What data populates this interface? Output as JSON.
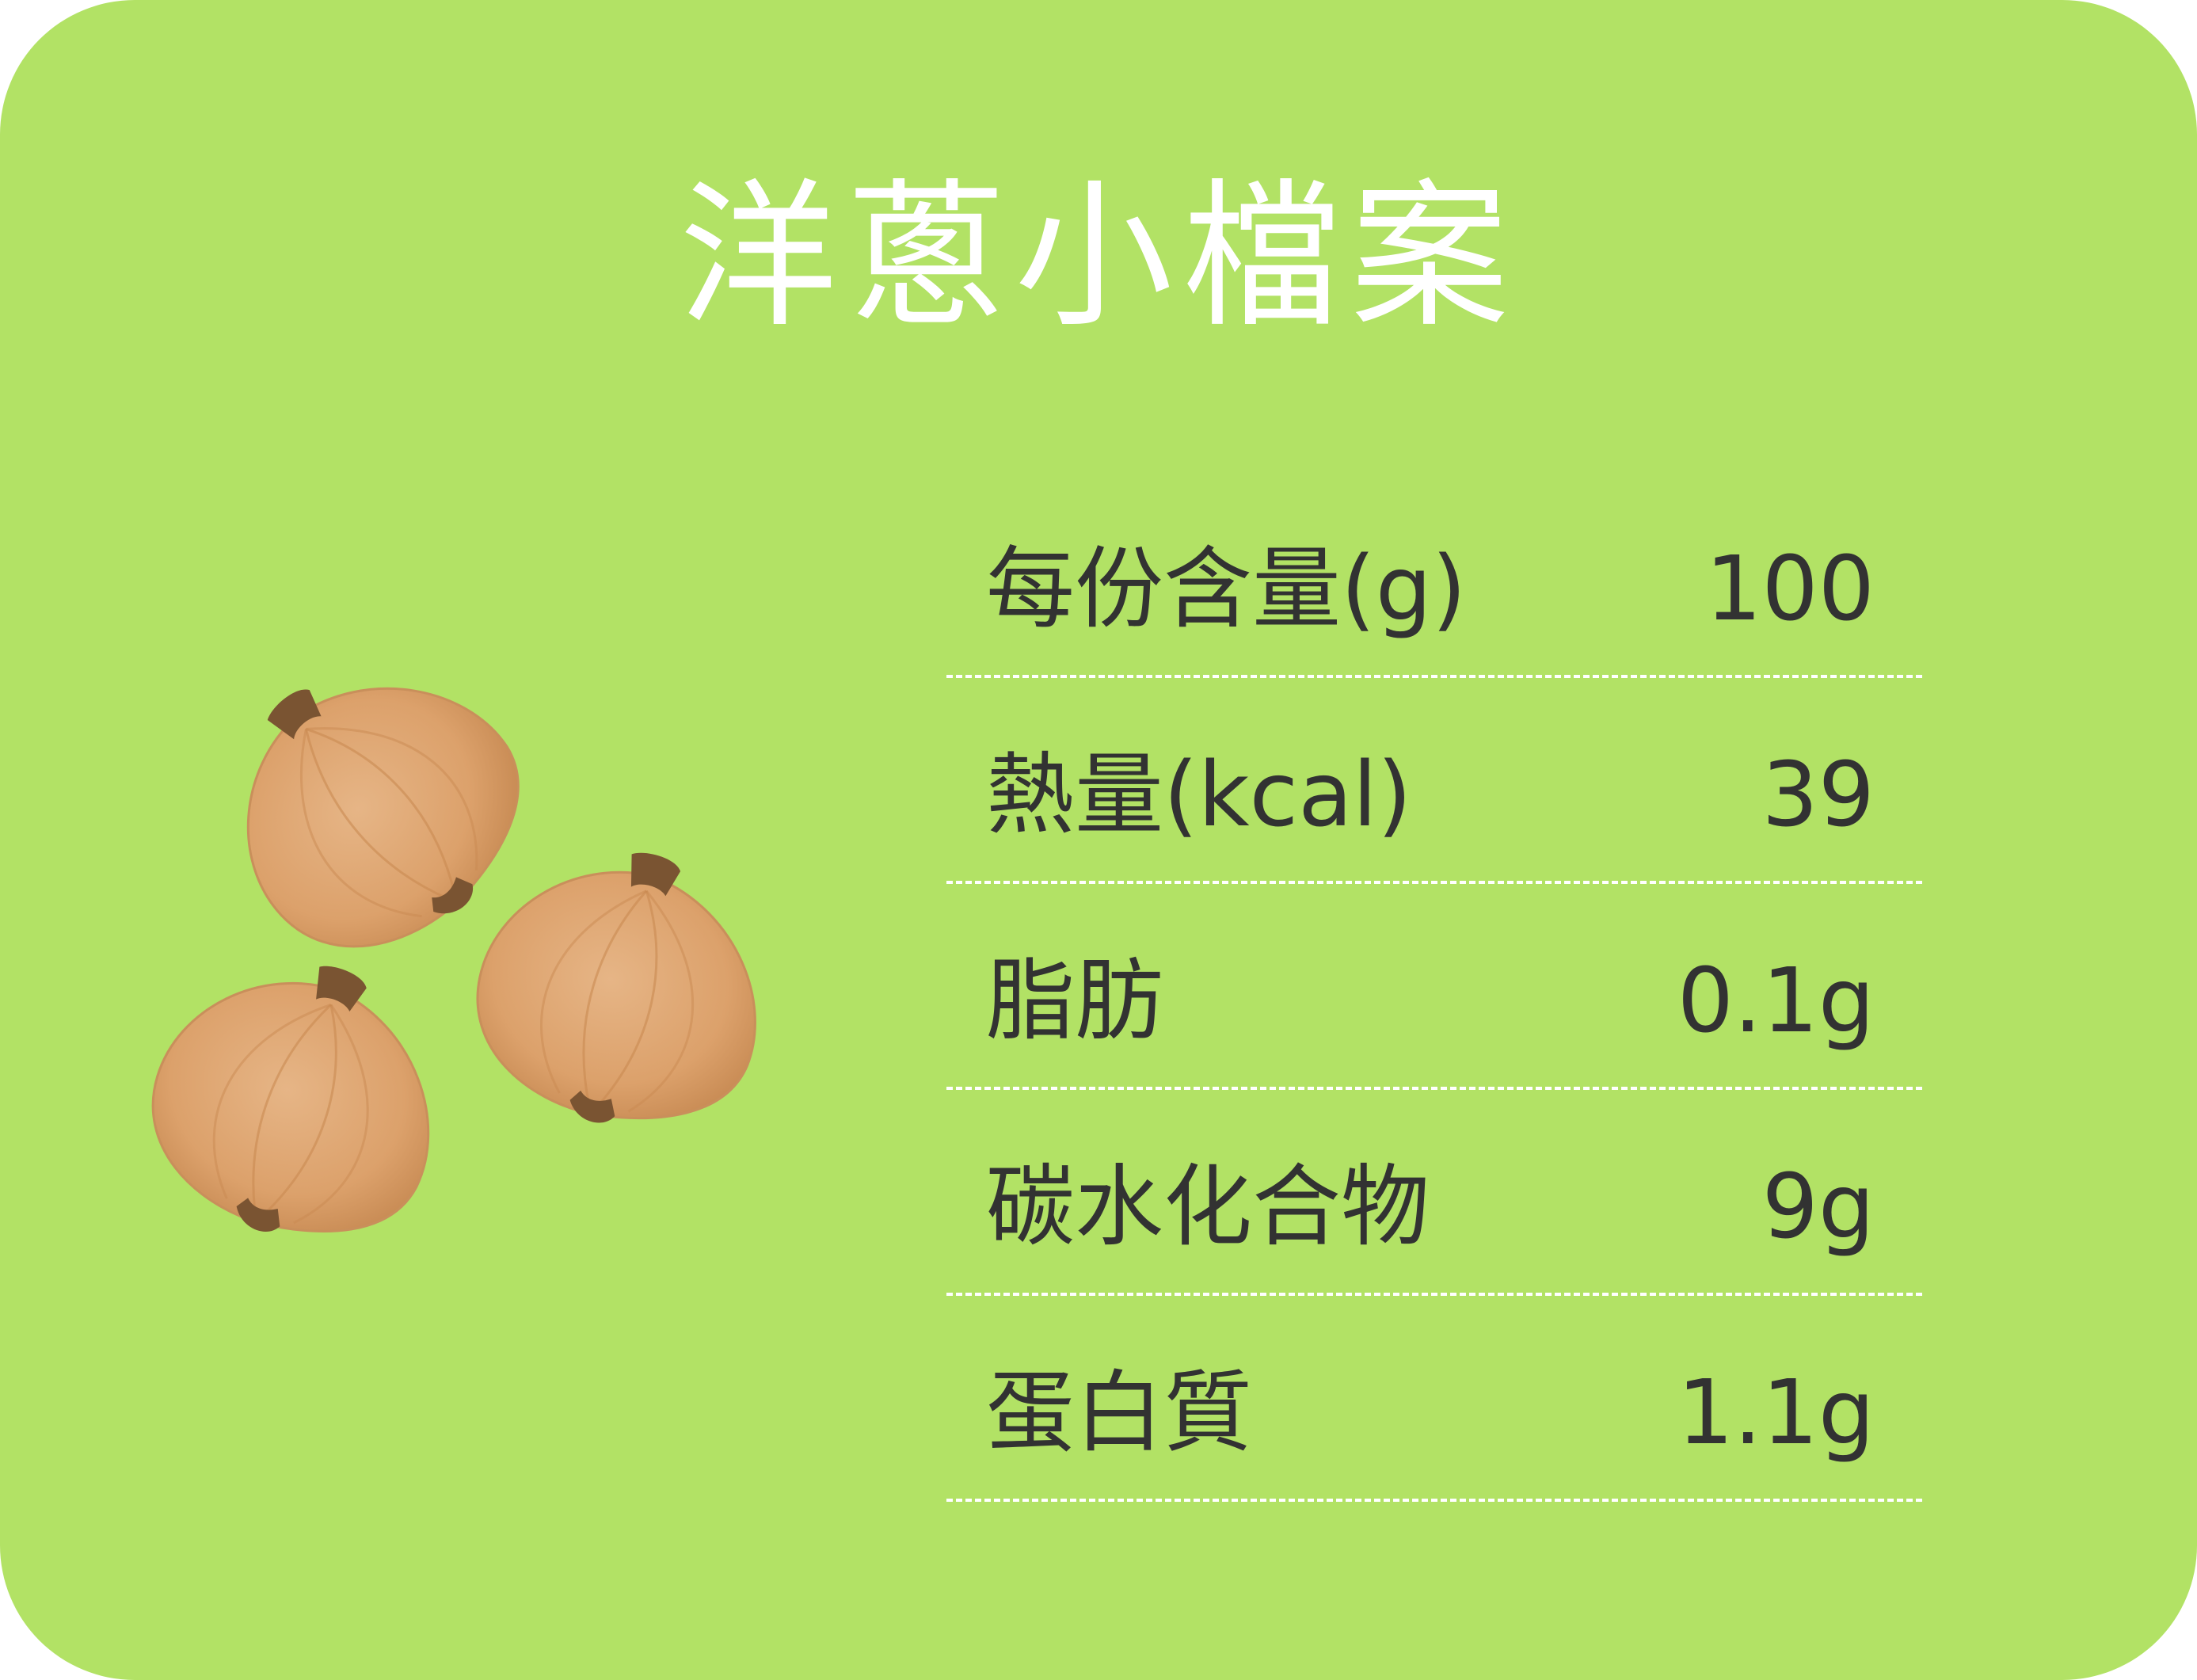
{
  "title": "洋蔥小檔案",
  "colors": {
    "background": "#b2e265",
    "title_text": "#ffffff",
    "body_text": "#323232",
    "divider": "#ffffff",
    "onion_flesh": "#dfa876",
    "onion_root": "#7a5432"
  },
  "illustration": {
    "icon": "onion-icon",
    "count": 3
  },
  "nutrition": {
    "rows": [
      {
        "label": "每份含量(g)",
        "value": "100"
      },
      {
        "label": "熱量(kcal)",
        "value": "39"
      },
      {
        "label": "脂肪",
        "value": "0.1g"
      },
      {
        "label": "碳水化合物",
        "value": "9g"
      },
      {
        "label": "蛋白質",
        "value": "1.1g"
      }
    ]
  }
}
